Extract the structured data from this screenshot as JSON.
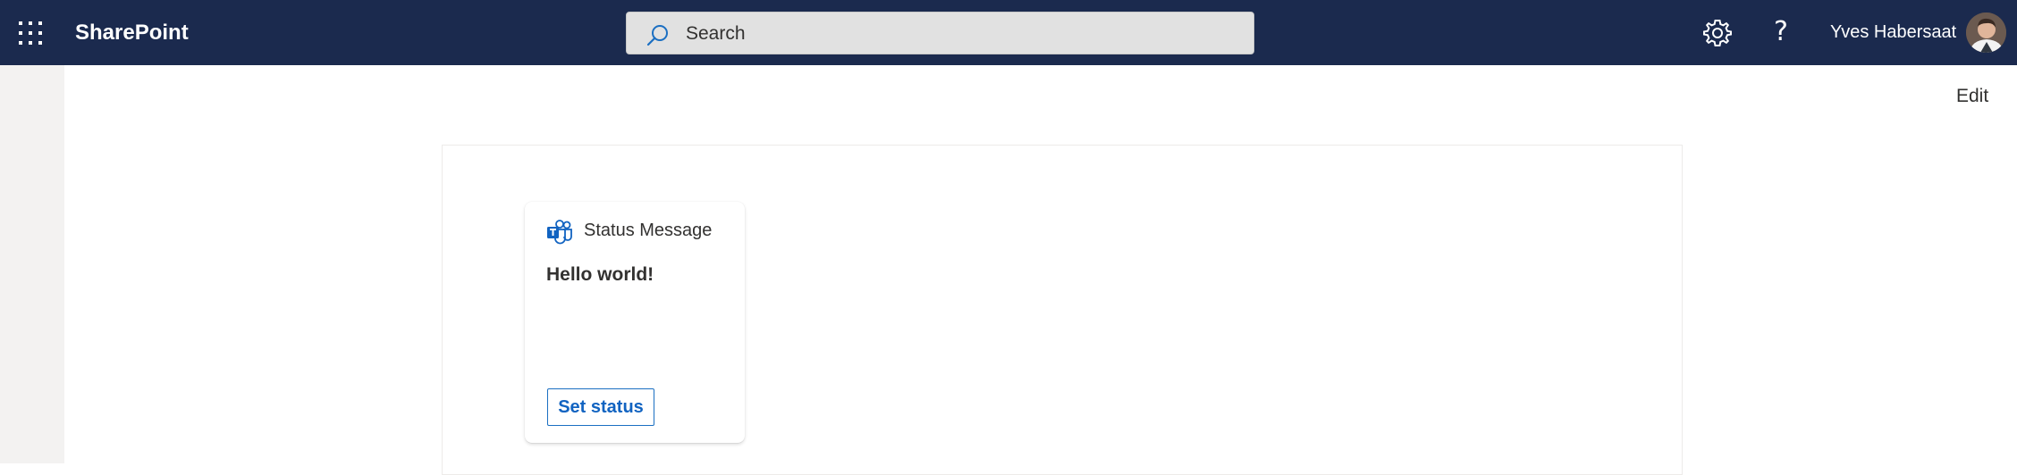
{
  "header": {
    "app_name": "SharePoint",
    "waffle_icon": "app-launcher-icon",
    "search_placeholder": "Search",
    "search_icon": "search-icon",
    "settings_icon": "gear-icon",
    "help_label": "?",
    "user_name": "Yves Habersaat",
    "colors": {
      "bar": "#1b2a4e",
      "search_bg": "#e1e1e1"
    }
  },
  "page": {
    "edit_label": "Edit"
  },
  "card": {
    "icon": "teams-icon",
    "title": "Status Message",
    "message": "Hello world!",
    "button_label": "Set status",
    "accent": "#1163c1"
  }
}
